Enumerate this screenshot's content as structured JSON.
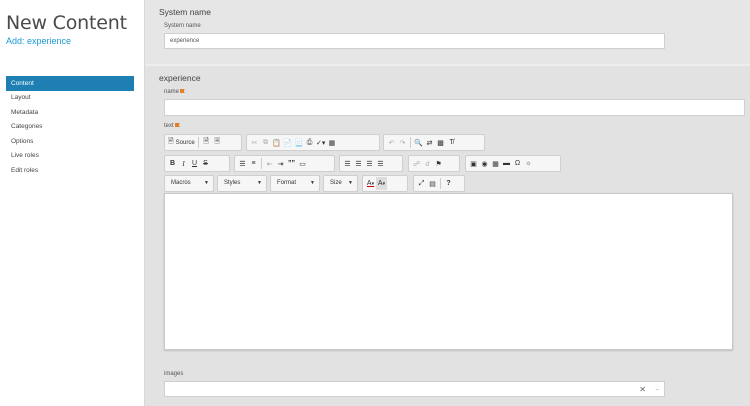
{
  "sidebar": {
    "title": "New Content",
    "subtitle": "Add: experience",
    "items": [
      {
        "label": "Content",
        "active": true
      },
      {
        "label": "Layout"
      },
      {
        "label": "Metadata"
      },
      {
        "label": "Categories"
      },
      {
        "label": "Options"
      },
      {
        "label": "Live roles"
      },
      {
        "label": "Edit roles"
      }
    ]
  },
  "system_section": {
    "title": "System name",
    "field_label": "System name",
    "value": "experience"
  },
  "content_section": {
    "title": "experience",
    "name_label": "name",
    "name_value": "",
    "text_label": "text",
    "images_label": "images"
  },
  "toolbar": {
    "source_label": "Source",
    "macros_label": "Macros",
    "styles_label": "Styles",
    "format_label": "Format",
    "size_label": "Size",
    "bold": "B",
    "italic": "I",
    "underline": "U",
    "strike": "S",
    "quote": "””",
    "textcolor": "A",
    "bgcolor": "A",
    "help": "?",
    "omega": "Ω"
  },
  "colors": {
    "accent": "#1a9ad6",
    "active_menu": "#1e7fb3",
    "required": "#e67e22"
  }
}
